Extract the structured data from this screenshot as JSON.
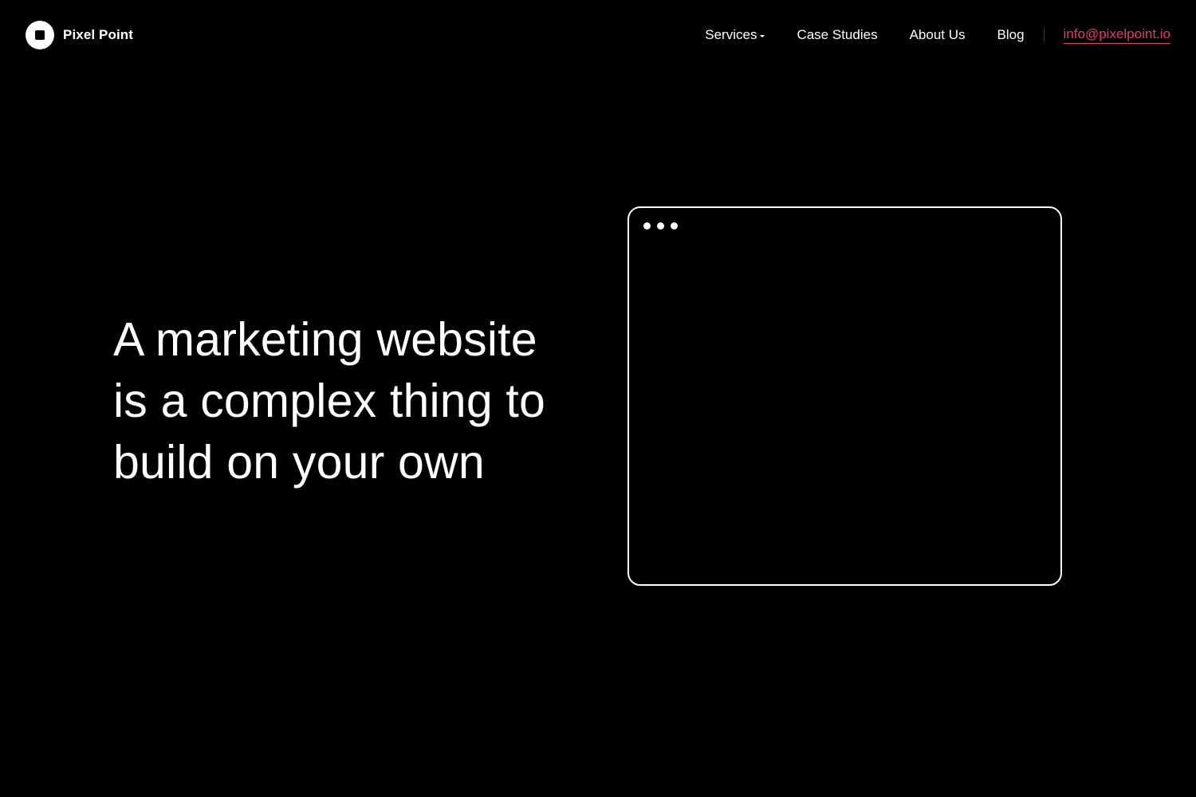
{
  "header": {
    "logo": {
      "text": "Pixel Point",
      "icon": "square-in-circle-logo-icon"
    },
    "nav": {
      "items": [
        {
          "label": "Services",
          "has_dropdown": true,
          "icon": "caret-down-icon"
        },
        {
          "label": "Case Studies",
          "has_dropdown": false
        },
        {
          "label": "About Us",
          "has_dropdown": false
        },
        {
          "label": "Blog",
          "has_dropdown": false
        }
      ],
      "email": "info@pixelpoint.io"
    }
  },
  "hero": {
    "title_lines": [
      "A marketing website",
      "is a complex thing to",
      "build on your own"
    ],
    "illustration": {
      "type": "browser-window",
      "dots_icon": "window-controls-dots-icon"
    }
  },
  "colors": {
    "background": "#000000",
    "text": "#ffffff",
    "accent": "#e8376a"
  }
}
